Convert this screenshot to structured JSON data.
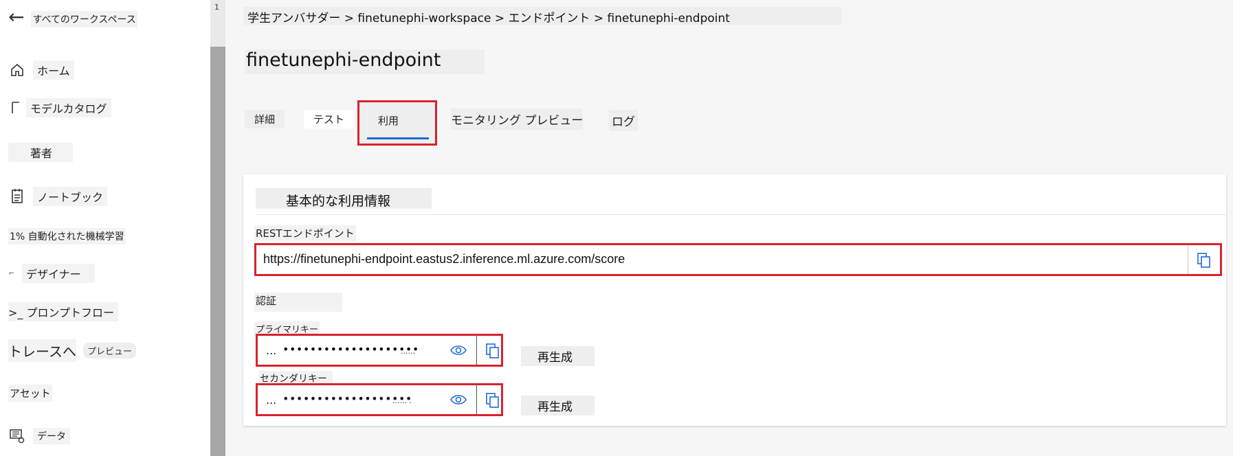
{
  "sidebar": {
    "back_label": "すべてのワークスペース",
    "scroll_mark": "1",
    "items": [
      {
        "icon": "home-icon",
        "glyph": "⌂",
        "label": "ホーム"
      },
      {
        "icon": "model-catalog-icon",
        "glyph": "⊏",
        "label": "モデルカタログ"
      },
      {
        "icon": "",
        "glyph": "",
        "label": "著者"
      },
      {
        "icon": "notebook-icon",
        "glyph": "☰",
        "label": "ノートブック"
      },
      {
        "icon": "automl-icon",
        "glyph": "",
        "label": "1% 自動化された機械学習"
      },
      {
        "icon": "designer-icon",
        "glyph": "",
        "label": "デザイナー"
      },
      {
        "icon": "prompt-flow-icon",
        "glyph": ">_",
        "label": "プロンプトフロー"
      },
      {
        "icon": "",
        "glyph": "",
        "label": "トレースへ",
        "badge": "プレビュー"
      },
      {
        "icon": "",
        "glyph": "",
        "label": "アセット"
      },
      {
        "icon": "data-icon",
        "glyph": "▦",
        "label": "データ"
      }
    ]
  },
  "breadcrumb": "学生アンバサダー > finetunephi-workspace > エンドポイント > finetunephi-endpoint",
  "page_title": "finetunephi-endpoint",
  "tabs": [
    "詳細",
    "テスト",
    "利用",
    "モニタリング プレビュー",
    "ログ"
  ],
  "active_tab": "利用",
  "card": {
    "section_title": "基本的な利用情報",
    "rest_label": "RESTエンドポイント",
    "rest_url": "https://finetunephi-endpoint.eastus2.inference.ml.azure.com/score",
    "auth_label": "認証",
    "primary_label": "プライマリキー",
    "secondary_label": "セカンダリキー",
    "key_prefix": "...",
    "key_mask": "••••••••••••••••••••",
    "key_mask_secondary": "•••••••••••••••••••",
    "key_trail": "......",
    "key_trail_secondary": "......  .",
    "regenerate_label": "再生成"
  },
  "colors": {
    "highlight": "#d9222d",
    "accent": "#1f6ad1"
  }
}
